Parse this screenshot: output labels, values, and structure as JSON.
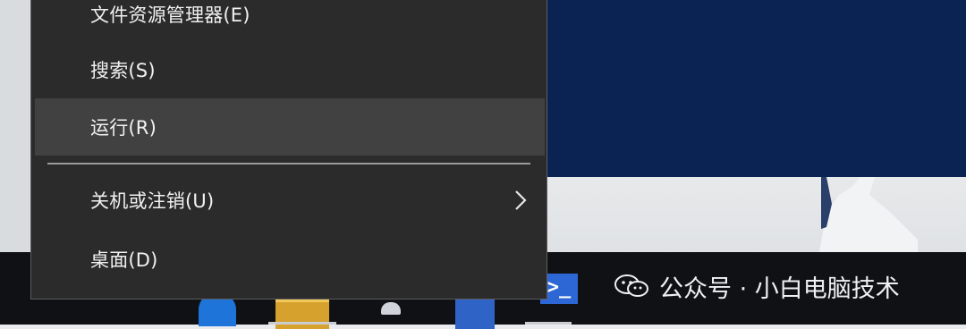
{
  "menu": {
    "items": [
      {
        "label": "文件资源管理器(E)"
      },
      {
        "label": "搜索(S)"
      },
      {
        "label": "运行(R)",
        "highlighted": true
      },
      {
        "label": "关机或注销(U)",
        "has_submenu": true,
        "submenu_icon": "chevron-right-icon"
      },
      {
        "label": "桌面(D)"
      }
    ]
  },
  "taskbar": {
    "icons": [
      "edge-icon",
      "folder-icon",
      "store-icon",
      "mail-icon",
      "terminal-icon"
    ],
    "terminal_glyph": ">_"
  },
  "watermark": {
    "text": "公众号 · 小白电脑技术",
    "icon": "wechat-icon"
  },
  "colors": {
    "menu_bg": "#2b2b2b",
    "menu_highlight": "#414141",
    "wallpaper": "#0b2352",
    "taskbar": "#0f1114"
  }
}
